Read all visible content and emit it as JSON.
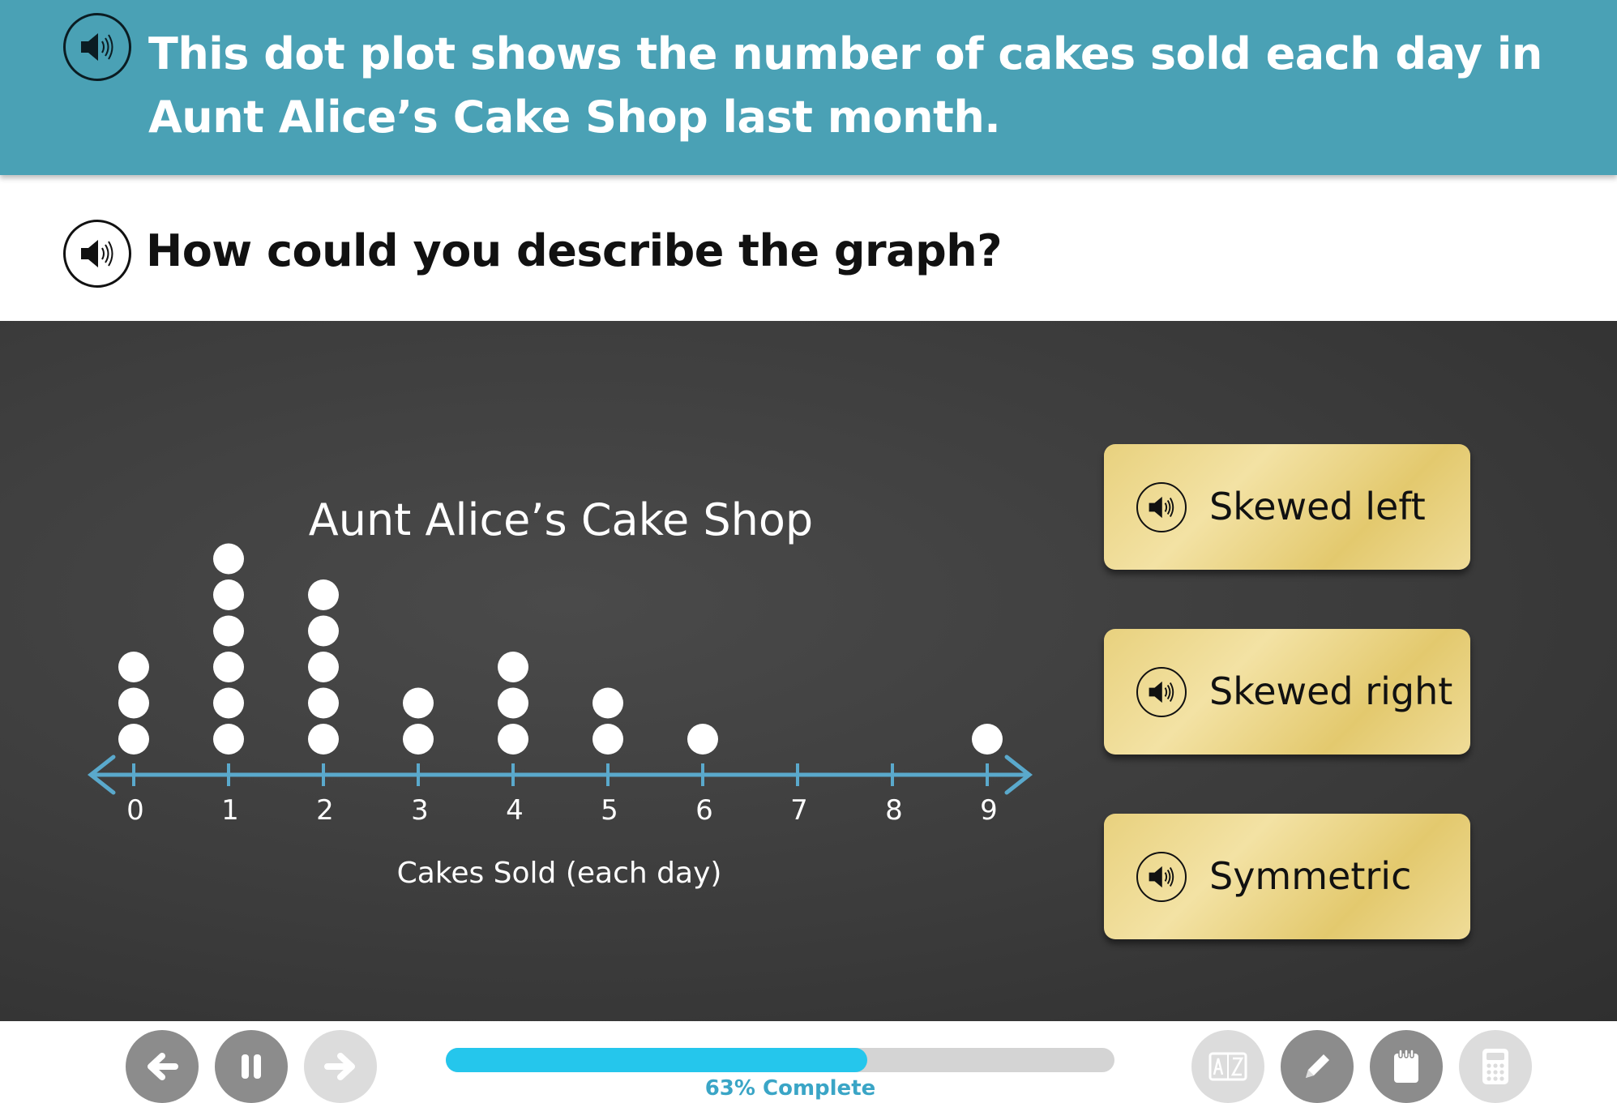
{
  "header": {
    "text": "This dot plot shows the number of cakes sold each day in Aunt Alice’s Cake Shop last month.",
    "speaker_icon": "speaker-icon"
  },
  "question": {
    "text": "How could you describe the graph?",
    "speaker_icon": "speaker-icon"
  },
  "chart_data": {
    "type": "scatter",
    "title": "Aunt Alice’s Cake Shop",
    "xlabel": "Cakes Sold (each day)",
    "ylabel": "",
    "categories": [
      "0",
      "1",
      "2",
      "3",
      "4",
      "5",
      "6",
      "7",
      "8",
      "9"
    ],
    "values": [
      3,
      6,
      5,
      2,
      3,
      2,
      1,
      0,
      0,
      1
    ],
    "xlim": [
      0,
      9
    ],
    "grid": false,
    "colors": {
      "dots": "#ffffff",
      "axis": "#5aa9cc"
    }
  },
  "answers": [
    {
      "label": "Skewed left"
    },
    {
      "label": "Skewed right"
    },
    {
      "label": "Symmetric"
    }
  ],
  "toolbar": {
    "back_icon": "back-arrow-icon",
    "pause_icon": "pause-icon",
    "next_icon": "forward-arrow-icon",
    "glossary_icon": "glossary-icon",
    "pencil_icon": "pencil-icon",
    "notepad_icon": "notepad-icon",
    "calculator_icon": "calculator-icon"
  },
  "progress": {
    "percent": 63,
    "label": "63% Complete"
  },
  "colors": {
    "header_bg": "#4aa1b5",
    "board_bg": "#3c3c3c",
    "answer_bg": "#ecd68a",
    "progress_fill": "#25c6ec",
    "progress_text": "#3aa5c6"
  }
}
